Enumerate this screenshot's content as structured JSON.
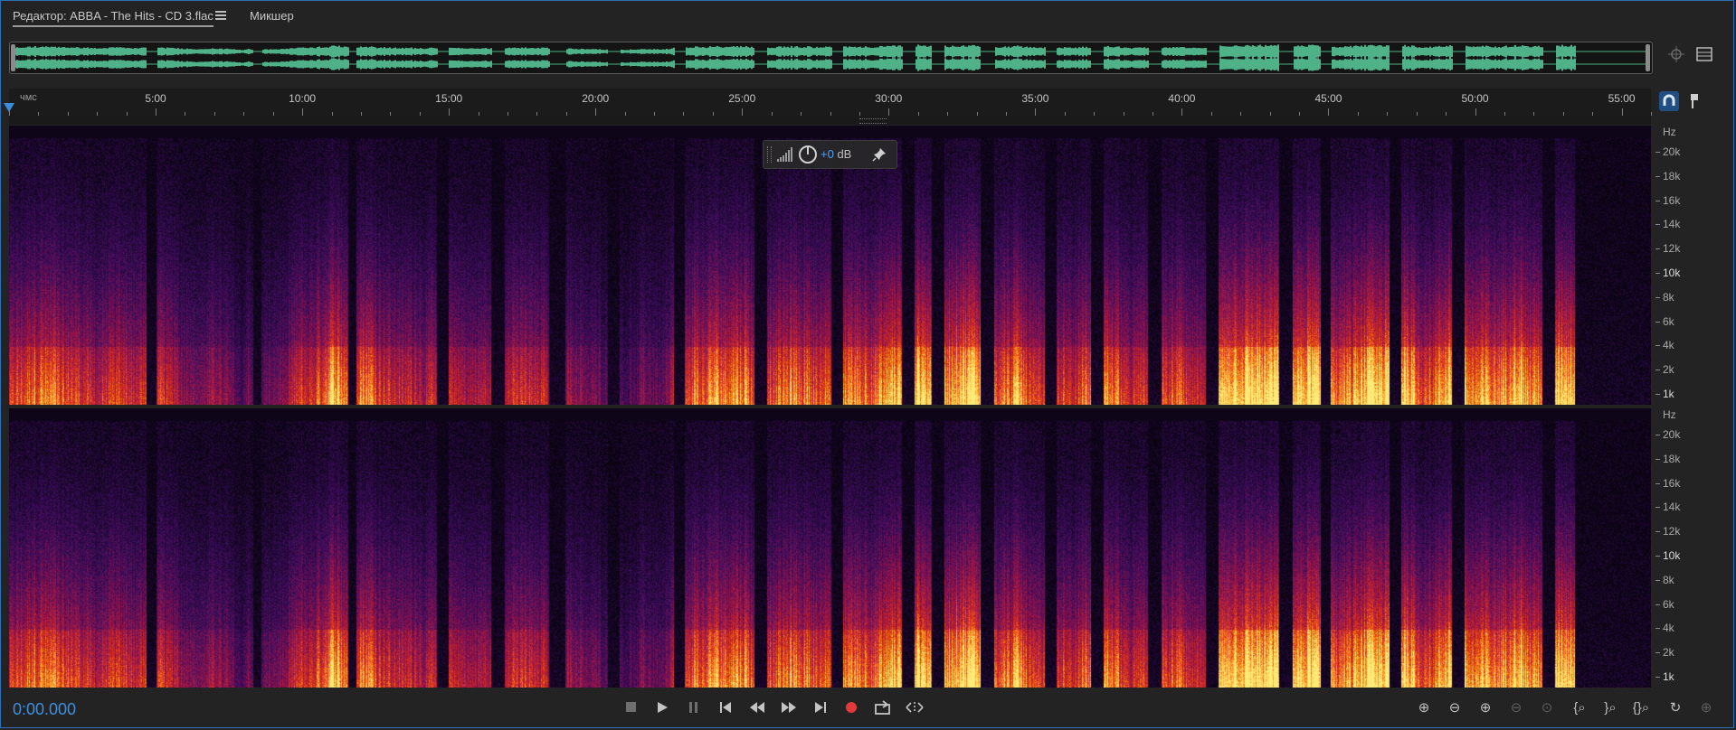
{
  "tabs": {
    "editor_label": "Редактор: ABBA - The Hits - CD 3.flac",
    "mixer_label": "Микшер"
  },
  "ruler": {
    "unit_label": "чмс",
    "marks": [
      "5:00",
      "10:00",
      "15:00",
      "20:00",
      "25:00",
      "30:00",
      "35:00",
      "40:00",
      "45:00",
      "50:00",
      "55:00"
    ],
    "duration_minutes": 56
  },
  "hud": {
    "gain_prefix": "+0",
    "gain_unit": " dB"
  },
  "frequency_axis": {
    "unit": "Hz",
    "labels": [
      {
        "text": "20k",
        "bold": false
      },
      {
        "text": "18k",
        "bold": false
      },
      {
        "text": "16k",
        "bold": false
      },
      {
        "text": "14k",
        "bold": false
      },
      {
        "text": "12k",
        "bold": false
      },
      {
        "text": "10k",
        "bold": true
      },
      {
        "text": "8k",
        "bold": false
      },
      {
        "text": "6k",
        "bold": false
      },
      {
        "text": "4k",
        "bold": false
      },
      {
        "text": "2k",
        "bold": false
      },
      {
        "text": "1k",
        "bold": true
      }
    ]
  },
  "transport": {
    "timecode": "0:00.000"
  },
  "colors": {
    "waveform": "#5fd9a6",
    "accent_blue": "#3d8fe0",
    "record_red": "#e03a3a"
  },
  "icons": {
    "tab_menu": "hamburger-icon",
    "overview_zoom": "zoom-crosshair-icon",
    "panel_toggle": "panel-menu-icon",
    "snap": "magnet-icon",
    "marker": "marker-flag-icon"
  }
}
